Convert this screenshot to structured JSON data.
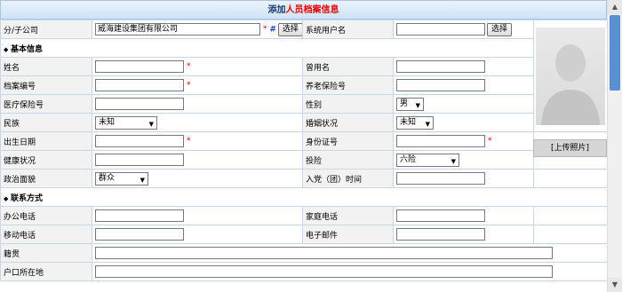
{
  "form": {
    "title_prefix": "添加",
    "title_highlight": "人员档案信息",
    "company_label": "分/子公司",
    "company_value": "威海建设集团有限公司",
    "required_mark": "*",
    "hash_mark": "#",
    "select_button": "选择",
    "system_user_label": "系统用户名",
    "system_user_value": "",
    "section_basic": "基本信息",
    "section_contact": "联系方式",
    "upload_photo": "[上传照片]"
  },
  "basic": {
    "name_label": "姓名",
    "name_value": "",
    "former_name_label": "曾用名",
    "former_name_value": "",
    "archive_no_label": "档案编号",
    "archive_no_value": "",
    "pension_label": "养老保险号",
    "pension_value": "",
    "medical_label": "医疗保险号",
    "medical_value": "",
    "gender_label": "性别",
    "gender_value": "男",
    "ethnicity_label": "民族",
    "ethnicity_value": "未知",
    "marital_label": "婚姻状况",
    "marital_value": "未知",
    "birth_label": "出生日期",
    "birth_value": "",
    "id_label": "身份证号",
    "id_value": "",
    "health_label": "健康状况",
    "health_value": "",
    "insurance_label": "投险",
    "insurance_value": "六险",
    "political_label": "政治面貌",
    "political_value": "群众",
    "party_time_label": "入党（团）时间",
    "party_time_value": ""
  },
  "contact": {
    "office_phone_label": "办公电话",
    "office_phone_value": "",
    "home_phone_label": "家庭电话",
    "home_phone_value": "",
    "mobile_label": "移动电话",
    "mobile_value": "",
    "email_label": "电子邮件",
    "email_value": "",
    "native_label": "籍贯",
    "native_value": "",
    "household_label": "户口所在地",
    "household_value": ""
  },
  "icons": {
    "section_arrow": "◆",
    "caret": "▼",
    "scroll_up": "▲",
    "scroll_down": "▼"
  },
  "colors": {
    "title_red": "#e00000",
    "scroll_thumb": "#5a8fd0",
    "label_bg": "#f2f2f2"
  }
}
